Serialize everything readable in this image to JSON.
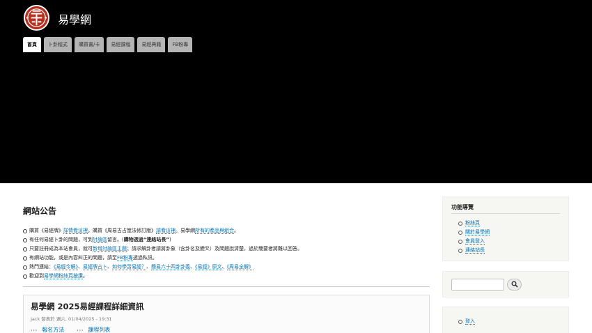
{
  "site": {
    "name": "易學網"
  },
  "nav_tabs": [
    {
      "label": "首頁",
      "active": true
    },
    {
      "label": "卜卦程式"
    },
    {
      "label": "購買書/卡"
    },
    {
      "label": "易經課程"
    },
    {
      "label": "易經典籍"
    },
    {
      "label": "FB粉專"
    }
  ],
  "announcement": {
    "title": "網站公告",
    "items": [
      [
        "購買《易經牌》",
        "詳情看這裡",
        "。購買《周易古占筮法修訂版》",
        "請看這裡",
        "。易學網",
        "所有的產品與組合",
        "。"
      ],
      [
        "有任何易經卜卦的問題，可到",
        "討論區",
        "留言。(",
        "購物透過“連絡站長”",
        ")"
      ],
      [
        "只要註冊成為本站會員，就可",
        "新增討論區主題",
        "；請求解卦者請將卦象（含卦名及變爻）及問題說清楚，過於簡要者將難以回答。"
      ],
      [
        "有網站功能，或是內容糾正的問題，請至",
        "FB粉專",
        "透過私訊。"
      ],
      [
        "熱門連結：",
        "《易經今解》",
        "、",
        "易經牌占卜",
        "、",
        "如何學習易經？",
        "、",
        "簡易六十四卦卦義",
        "、",
        "《易經》原文",
        "、",
        "《周易全解》"
      ],
      [
        "歡迎到",
        "易學網粉絲頁按讚",
        "。"
      ]
    ]
  },
  "article": {
    "title": "易學網 2025易經課程詳細資訊",
    "meta": "Jack 發表於 週六, 01/04/2025 - 19:31",
    "links": [
      "報名方法",
      "課程列表"
    ],
    "arrow": "›››"
  },
  "sidebar": {
    "nav_title": "功能導覽",
    "nav_items": [
      "粉絲頁",
      "關於易學網",
      "會員登入",
      "連絡站長"
    ],
    "search_placeholder": "",
    "login_label": "登入"
  },
  "colors": {
    "header_bg": "#000000",
    "link": "#0071b3",
    "logo_red": "#b5301f"
  }
}
